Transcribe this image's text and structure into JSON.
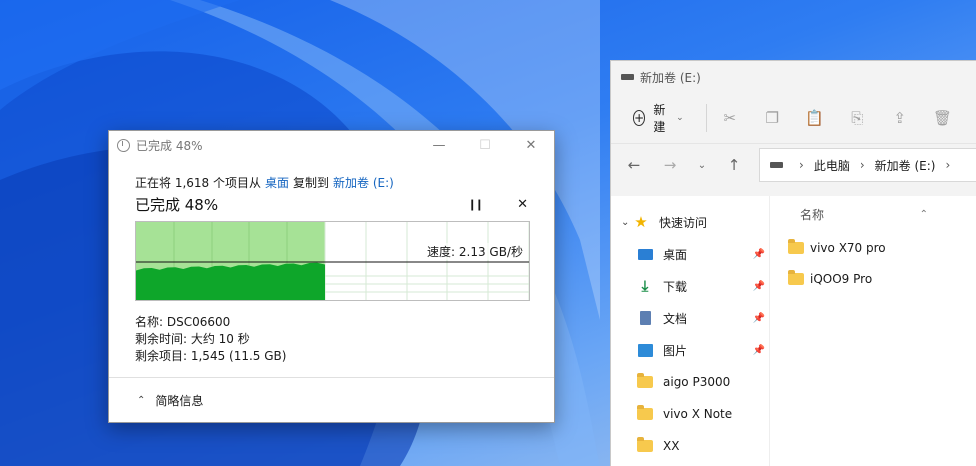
{
  "explorer": {
    "title": "新加卷 (E:)",
    "toolbar": {
      "new_label": "新建"
    },
    "address": {
      "crumbs": [
        "此电脑",
        "新加卷 (E:)"
      ]
    },
    "nav": {
      "quick_access": "快速访问",
      "items": [
        "桌面",
        "下载",
        "文档",
        "图片",
        "aigo P3000",
        "vivo X Note",
        "XX"
      ]
    },
    "content": {
      "column_name": "名称",
      "files": [
        "vivo X70 pro",
        "iQOO9 Pro"
      ]
    }
  },
  "dialog": {
    "title": "已完成 48%",
    "copy_prefix": "正在将 1,618 个项目从",
    "source": "桌面",
    "copy_mid": "复制到",
    "destination": "新加卷 (E:)",
    "percent_label": "已完成 48%",
    "progress": 0.48,
    "speed": "速度: 2.13 GB/秒",
    "name_line": "名称: DSC06600",
    "time_line": "剩余时间: 大约 10 秒",
    "items_line": "剩余项目: 1,545 (11.5 GB)",
    "fewer_details": "简略信息"
  }
}
